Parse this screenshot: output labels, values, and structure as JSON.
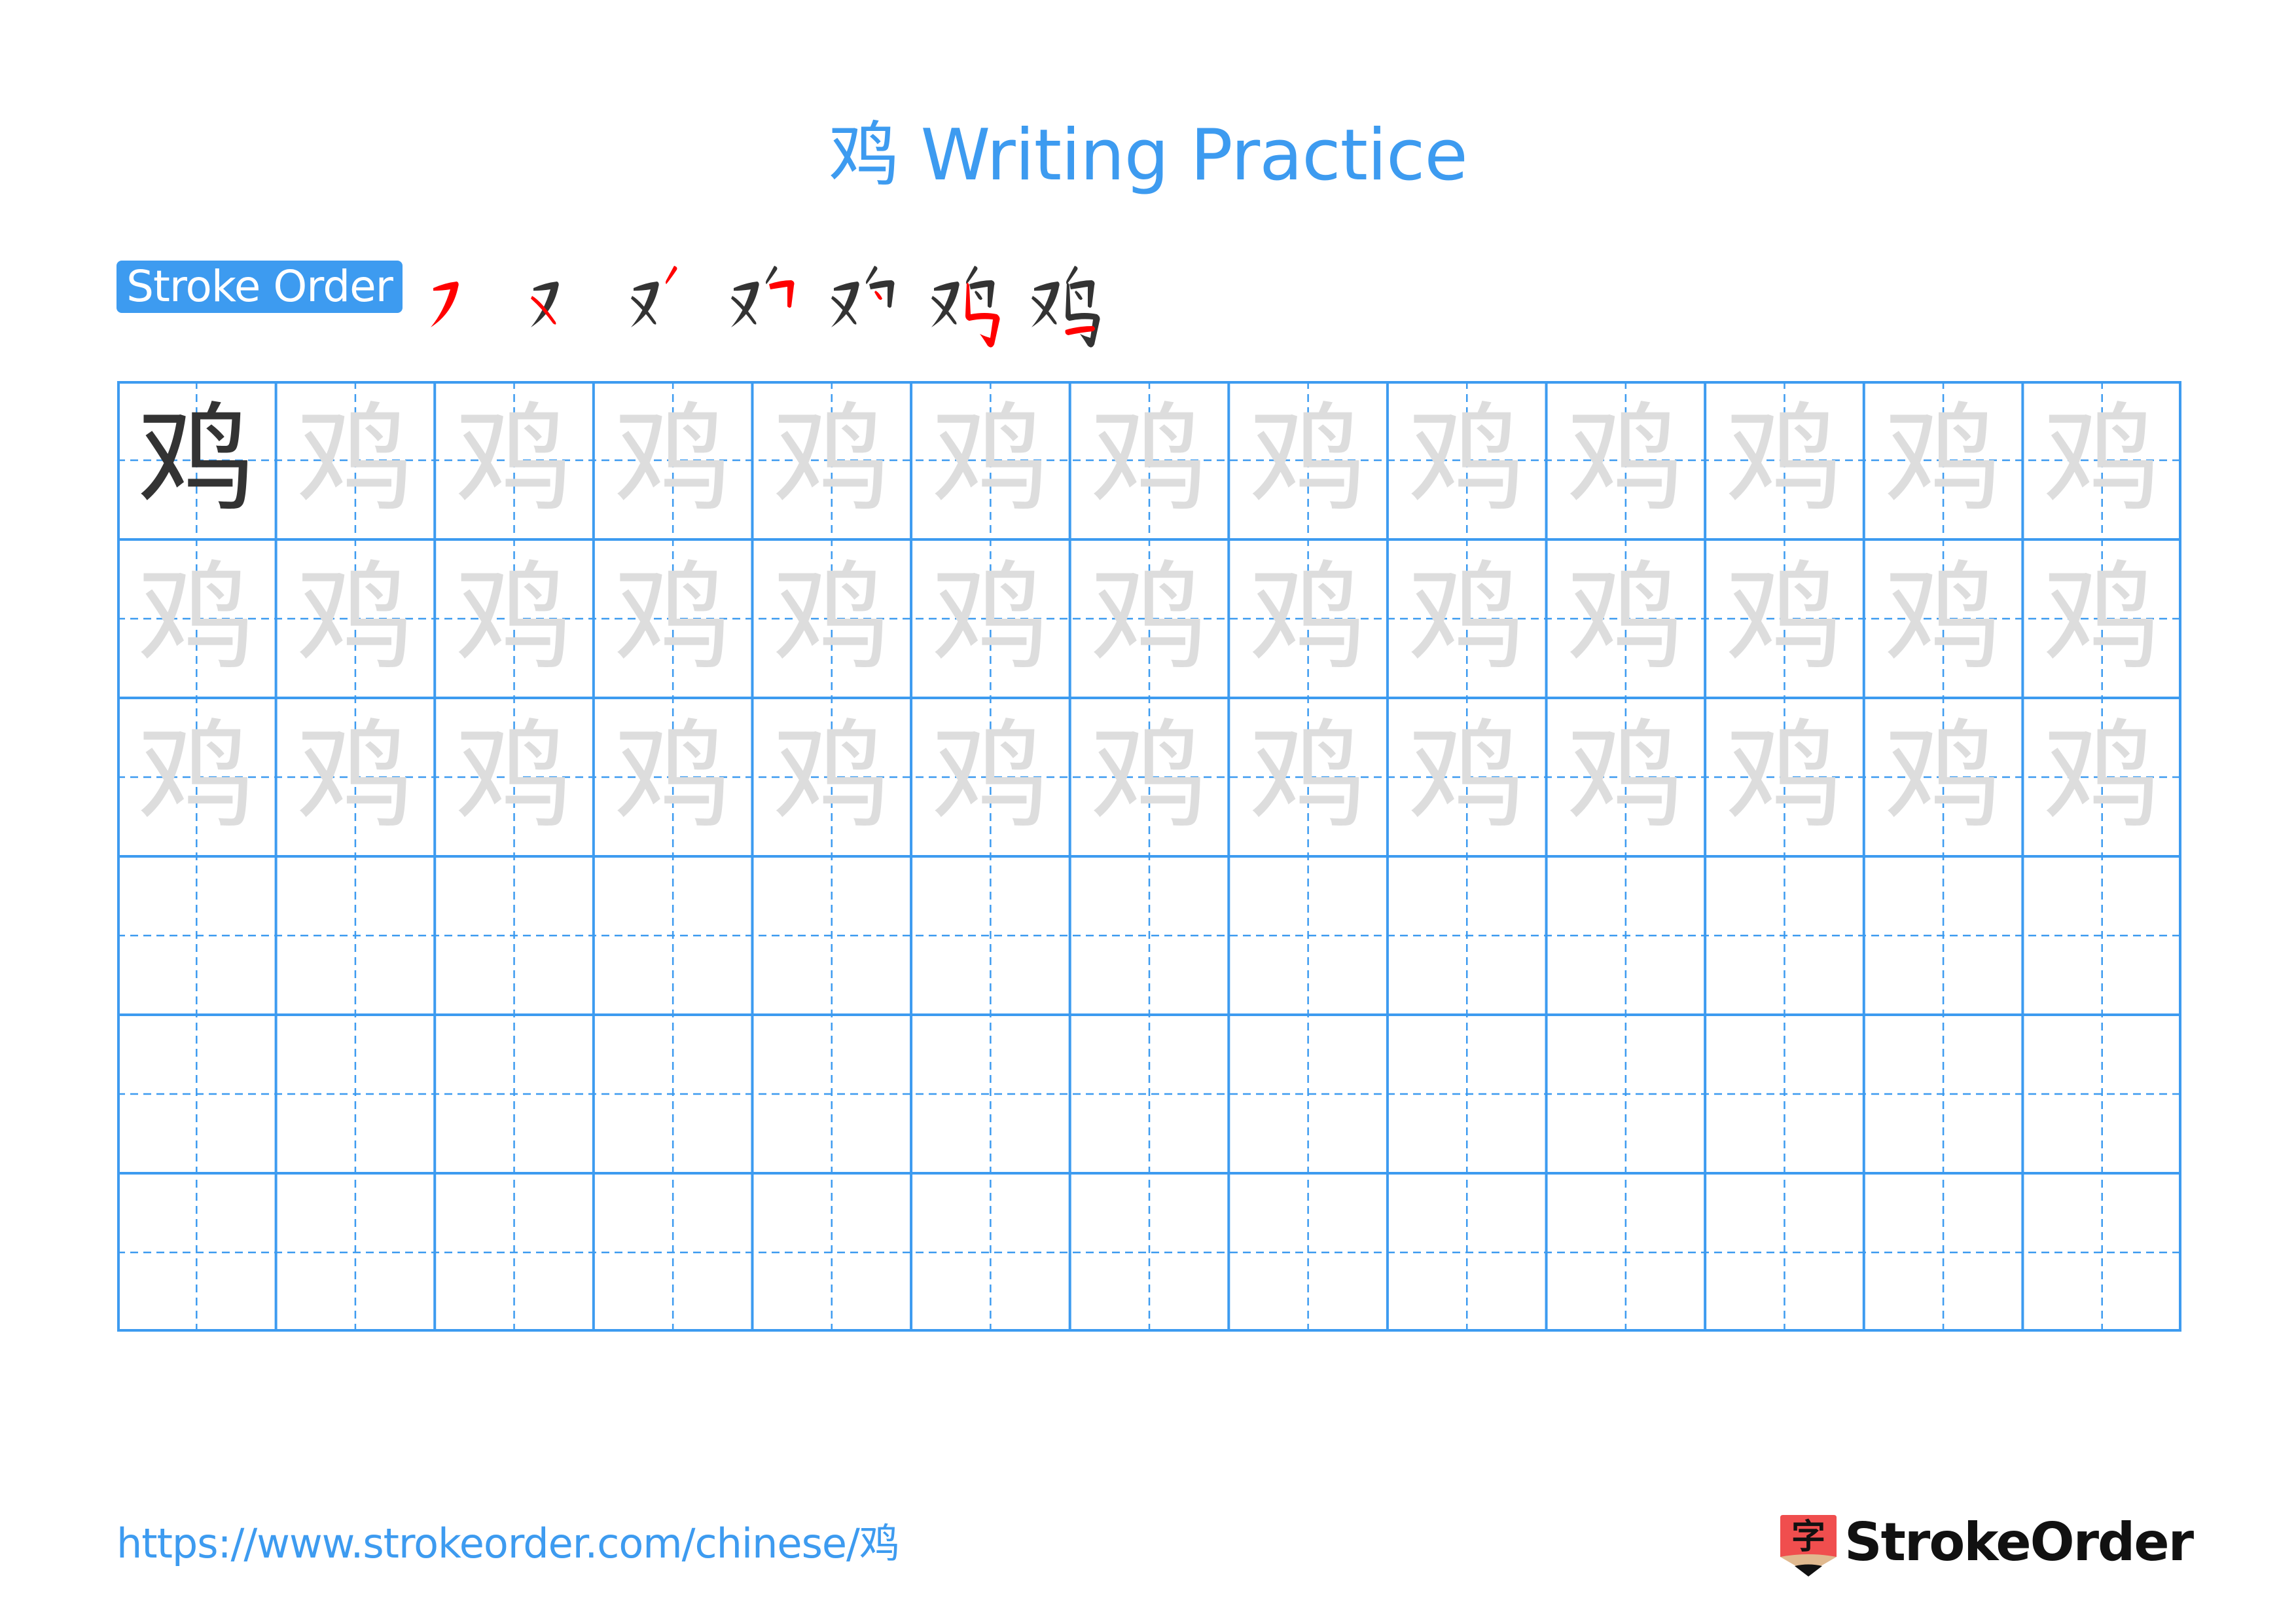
{
  "worksheet": {
    "character": "鸡",
    "title": "鸡 Writing Practice",
    "stroke_order_label": "Stroke Order",
    "stroke_count": 7,
    "stroke_steps": [
      {
        "step": 1,
        "done": [],
        "current": "s1"
      },
      {
        "step": 2,
        "done": [
          "s1"
        ],
        "current": "s2"
      },
      {
        "step": 3,
        "done": [
          "s1",
          "s2"
        ],
        "current": "s3"
      },
      {
        "step": 4,
        "done": [
          "s1",
          "s2",
          "s3"
        ],
        "current": "s4"
      },
      {
        "step": 5,
        "done": [
          "s1",
          "s2",
          "s3",
          "s4"
        ],
        "current": "s5"
      },
      {
        "step": 6,
        "done": [
          "s1",
          "s2",
          "s3",
          "s4",
          "s5"
        ],
        "current": "s6"
      },
      {
        "step": 7,
        "done": [
          "s1",
          "s2",
          "s3",
          "s4",
          "s5",
          "s6"
        ],
        "current": "s7"
      }
    ],
    "grid": {
      "columns": 13,
      "rows": 6,
      "row_types": [
        "model-then-trace",
        "trace",
        "trace",
        "empty",
        "empty",
        "empty"
      ]
    },
    "colors": {
      "accent": "#3d9bf0",
      "stroke_current": "#ff0000",
      "stroke_done": "#333333",
      "trace": "#dddddd",
      "logo_red": "#f04e4e",
      "logo_tan": "#e0b98f"
    }
  },
  "footer": {
    "url": "https://www.strokeorder.com/chinese/鸡",
    "logo_text": "StrokeOrder",
    "logo_glyph": "字"
  }
}
